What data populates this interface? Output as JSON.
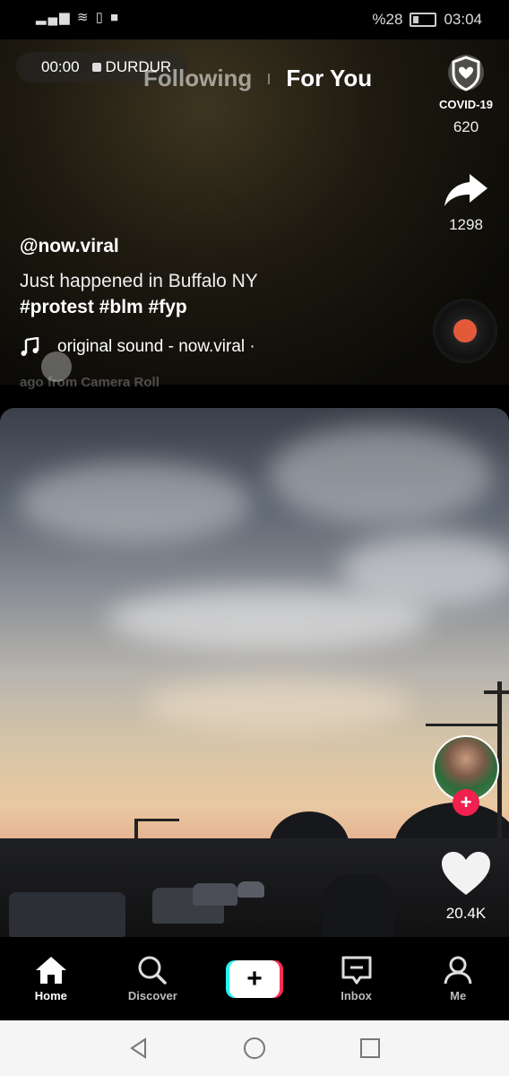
{
  "status_bar": {
    "signal_icons": "signal wifi vibrate notification",
    "battery_percent": "%28",
    "time": "03:04"
  },
  "recording": {
    "elapsed": "00:00",
    "stop_label": "DURDUR"
  },
  "feed_tabs": {
    "following": "Following",
    "for_you": "For You"
  },
  "covid": {
    "label": "COVID-19",
    "count": "620"
  },
  "share": {
    "count": "1298"
  },
  "post": {
    "username": "@now.viral",
    "caption": "Just happened in Buffalo NY",
    "hashtags": "#protest #blm #fyp",
    "sound": "original sound - now.viral ·",
    "faded_meta": "ago from Camera Roll"
  },
  "second_post": {
    "likes": "20.4K"
  },
  "bottom_nav": {
    "home": "Home",
    "discover": "Discover",
    "inbox": "Inbox",
    "me": "Me"
  },
  "colors": {
    "accent_red": "#fe2c55",
    "accent_cyan": "#25f4ee"
  }
}
